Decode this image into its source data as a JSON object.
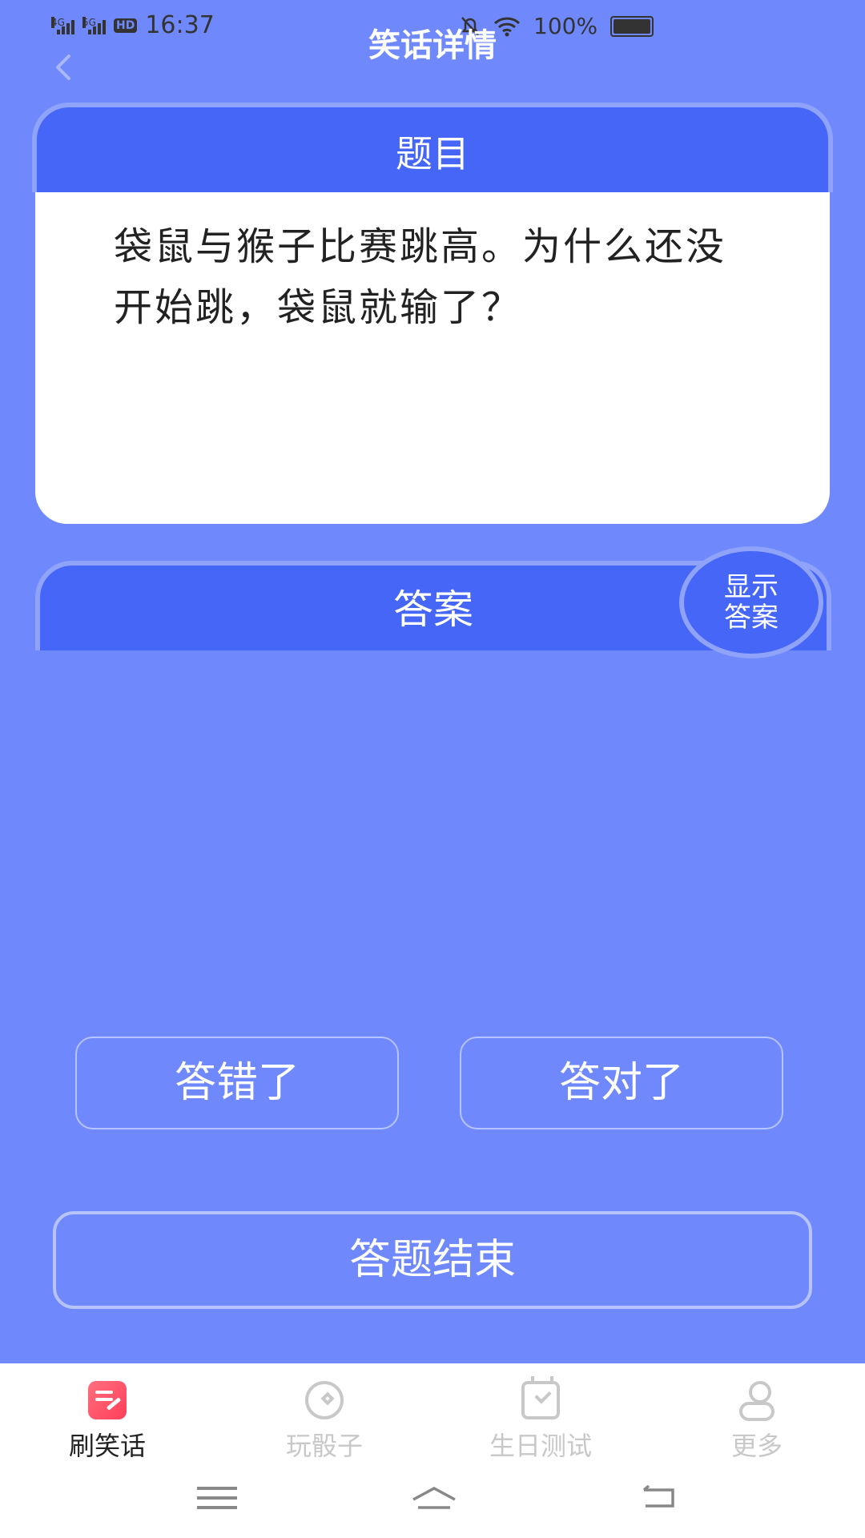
{
  "status_bar": {
    "net1": "4G",
    "net2": "5G",
    "hd": "HD",
    "time": "16:37",
    "battery": "100%"
  },
  "header": {
    "title": "笑话详情",
    "back_icon": "chevron-left-icon"
  },
  "question": {
    "header": "题目",
    "text": "袋鼠与猴子比赛跳高。为什么还没开始跳，袋鼠就输了？"
  },
  "answer": {
    "header": "答案",
    "show_button": "显示答案"
  },
  "choices": {
    "wrong": "答错了",
    "right": "答对了"
  },
  "end_button": "答题结束",
  "tabs": [
    {
      "label": "刷笑话",
      "icon": "joke-edit-icon",
      "active": true
    },
    {
      "label": "玩骰子",
      "icon": "dice-icon",
      "active": false
    },
    {
      "label": "生日测试",
      "icon": "calendar-check-icon",
      "active": false
    },
    {
      "label": "更多",
      "icon": "user-icon",
      "active": false
    }
  ],
  "colors": {
    "background": "#6f89fc",
    "card_header": "#4566f6",
    "active_tab_icon": "#ff4f66"
  }
}
